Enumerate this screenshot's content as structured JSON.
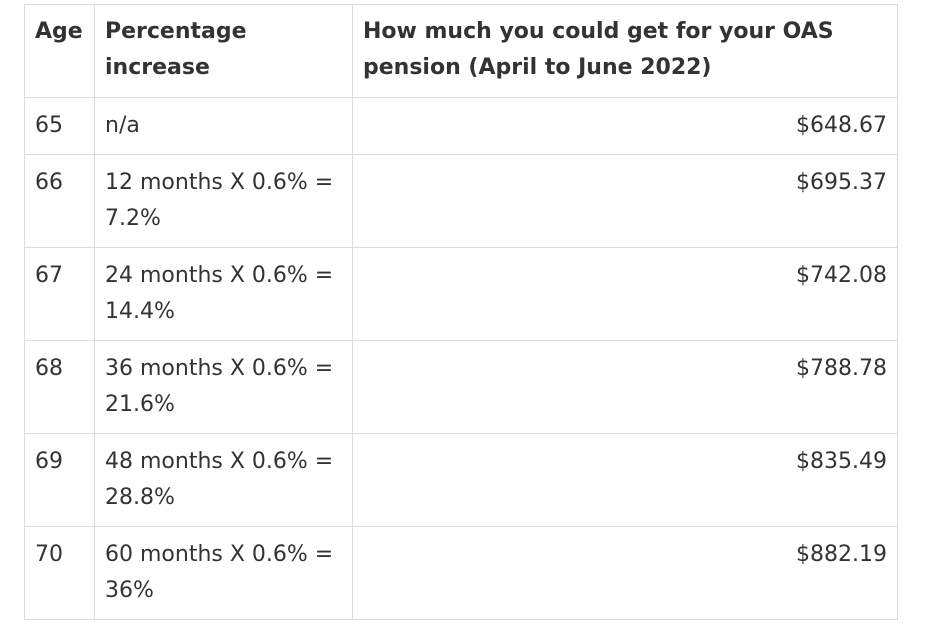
{
  "table": {
    "headers": {
      "age": "Age",
      "percentage": "Percentage increase",
      "amount": "How much you could get for your OAS pension (April to June 2022)"
    },
    "rows": [
      {
        "age": "65",
        "percentage": "n/a",
        "amount": "$648.67"
      },
      {
        "age": "66",
        "percentage": "12 months X 0.6% = 7.2%",
        "amount": "$695.37"
      },
      {
        "age": "67",
        "percentage": "24 months X 0.6% = 14.4%",
        "amount": "$742.08"
      },
      {
        "age": "68",
        "percentage": "36 months X 0.6% = 21.6%",
        "amount": "$788.78"
      },
      {
        "age": "69",
        "percentage": "48 months X 0.6% = 28.8%",
        "amount": "$835.49"
      },
      {
        "age": "70",
        "percentage": "60 months X 0.6% = 36%",
        "amount": "$882.19"
      }
    ]
  }
}
